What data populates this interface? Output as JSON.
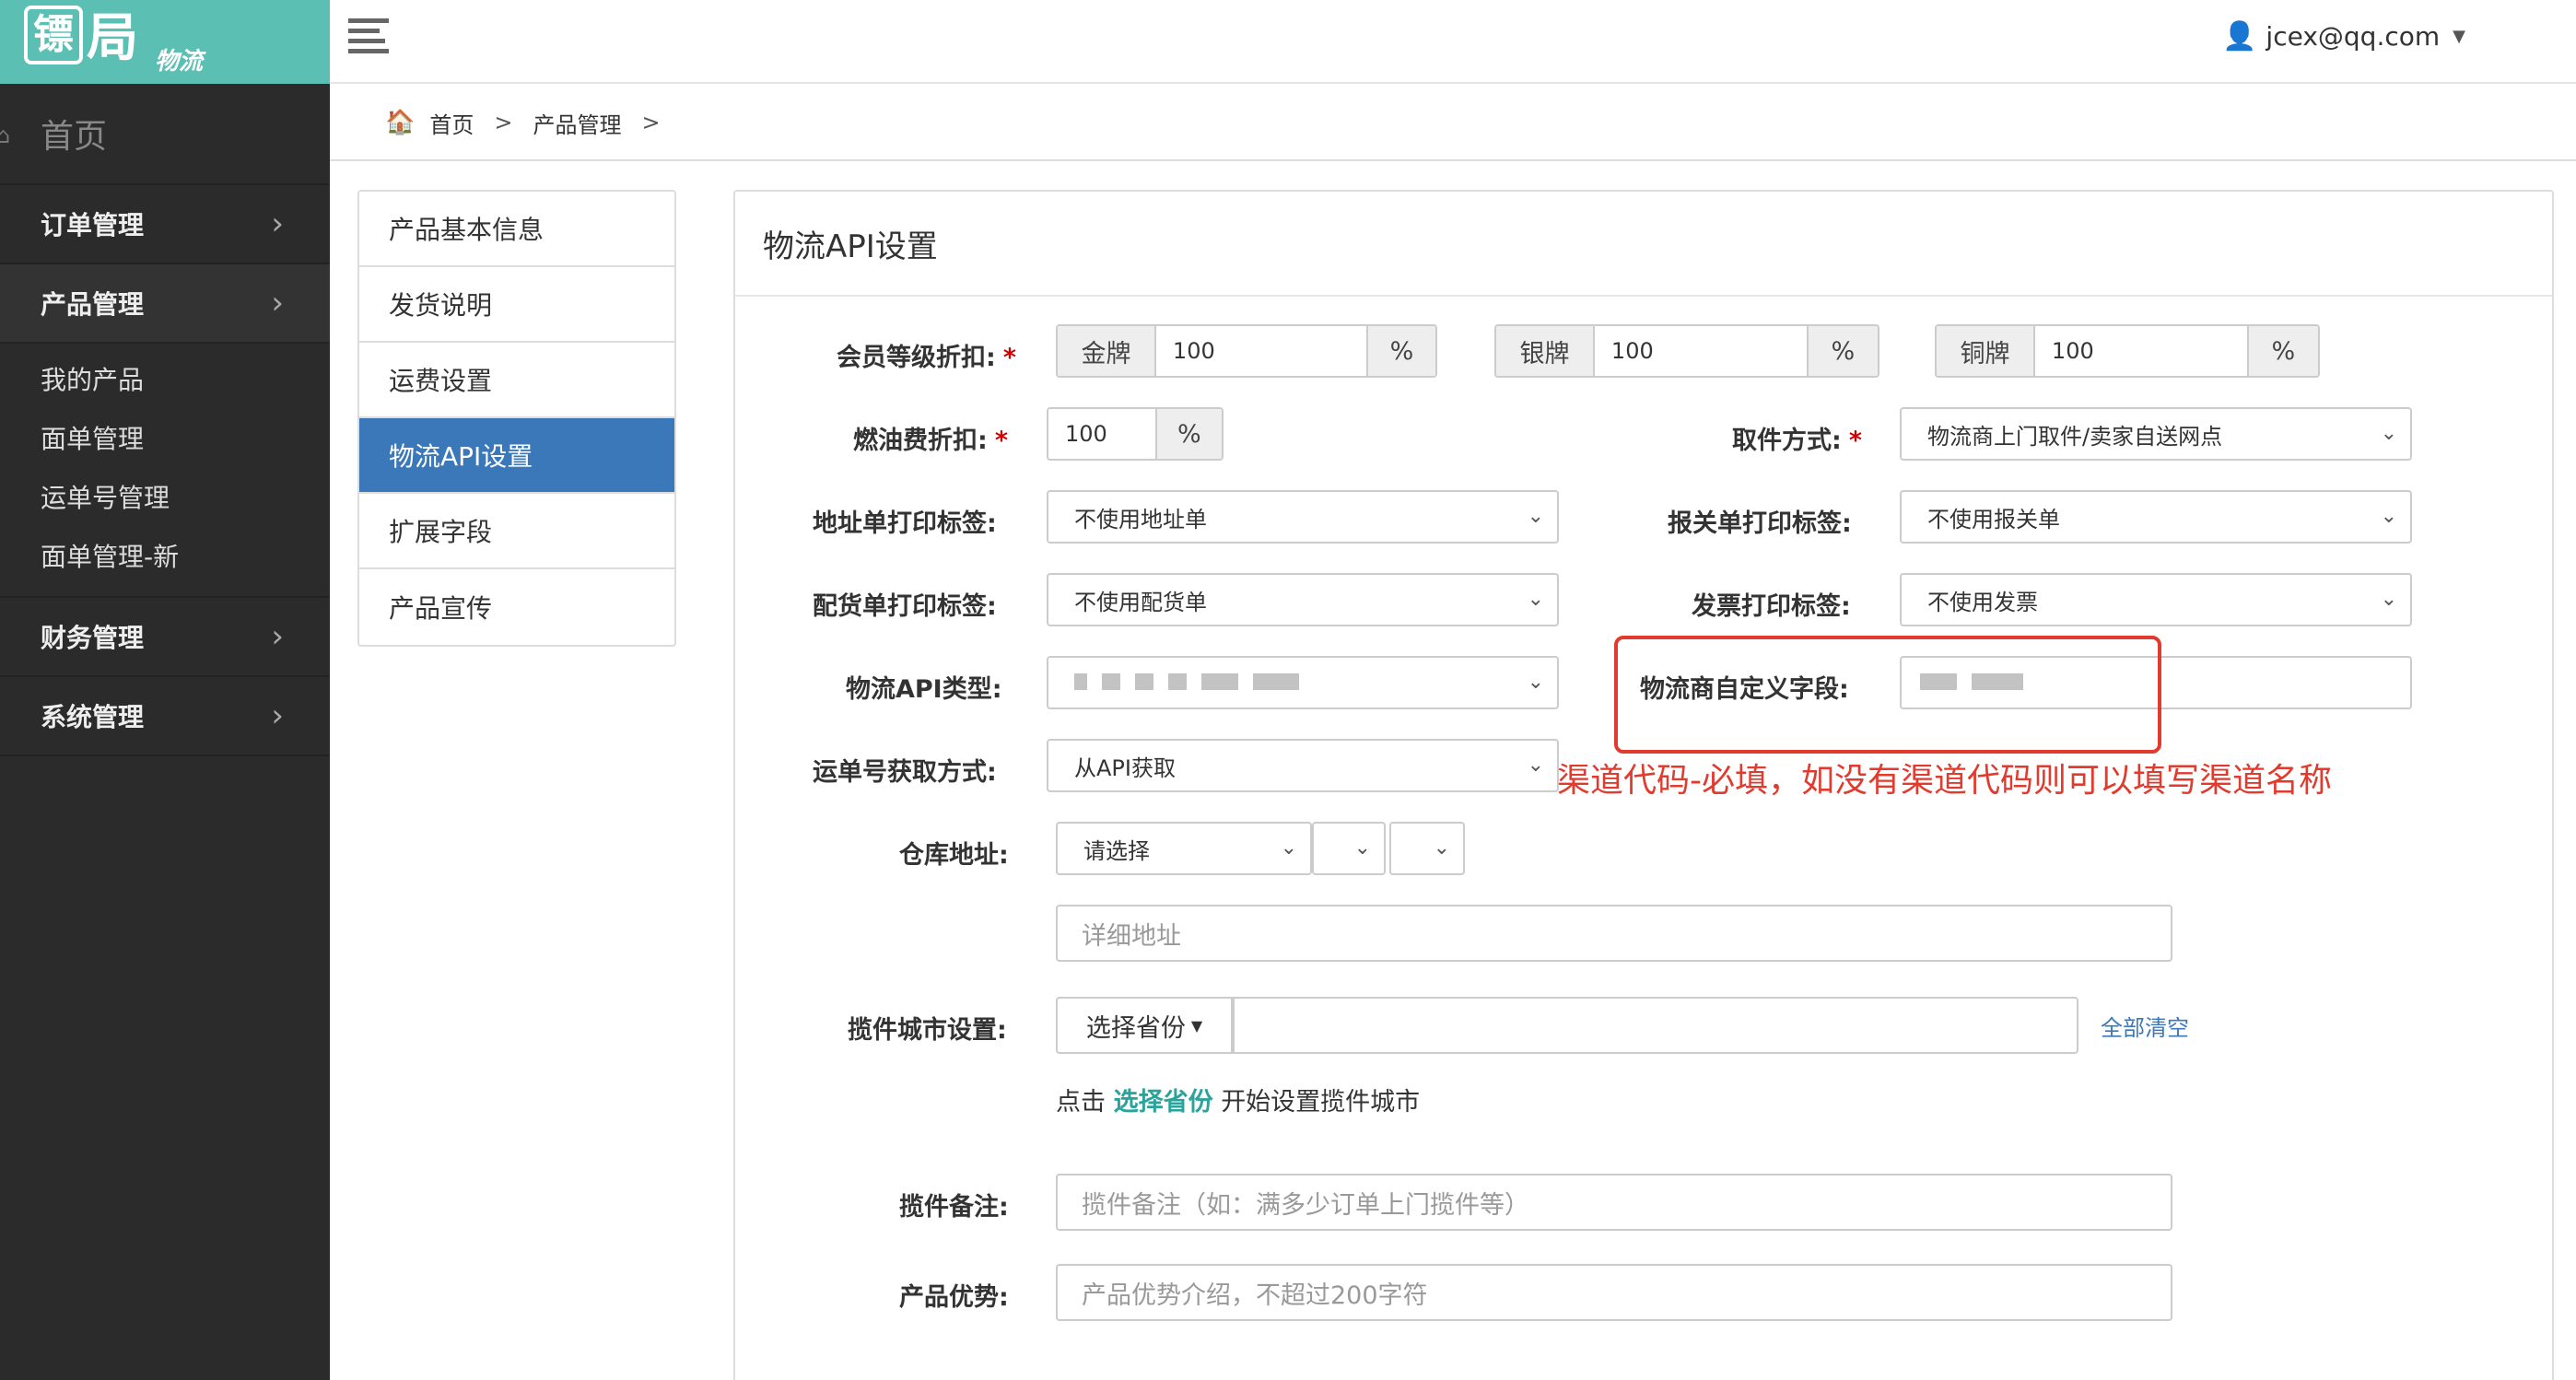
{
  "app": {
    "logo_mark": "镖",
    "logo_text": "局",
    "logo_sub": "物流"
  },
  "sidebar": {
    "home": "首页",
    "items": [
      {
        "label": "订单管理"
      },
      {
        "label": "产品管理"
      },
      {
        "label": "财务管理"
      },
      {
        "label": "系统管理"
      }
    ],
    "sub_items": [
      "我的产品",
      "面单管理",
      "运单号管理",
      "面单管理-新"
    ]
  },
  "topbar": {
    "user": "jcex@qq.com"
  },
  "breadcrumb": {
    "items": [
      "首页",
      "产品管理"
    ],
    "sep": ">"
  },
  "submenu": {
    "items": [
      "产品基本信息",
      "发货说明",
      "运费设置",
      "物流API设置",
      "扩展字段",
      "产品宣传"
    ]
  },
  "panel": {
    "title": "物流API设置"
  },
  "form": {
    "member_discount": {
      "label": "会员等级折扣:",
      "gold": {
        "name": "金牌",
        "value": "100",
        "unit": "%"
      },
      "silver": {
        "name": "银牌",
        "value": "100",
        "unit": "%"
      },
      "bronze": {
        "name": "铜牌",
        "value": "100",
        "unit": "%"
      }
    },
    "fuel_discount": {
      "label": "燃油费折扣:",
      "value": "100",
      "unit": "%"
    },
    "pickup": {
      "label": "取件方式:",
      "value": "物流商上门取件/卖家自送网点"
    },
    "address_label": {
      "label": "地址单打印标签:",
      "value": "不使用地址单"
    },
    "customs_label": {
      "label": "报关单打印标签:",
      "value": "不使用报关单"
    },
    "packing_label": {
      "label": "配货单打印标签:",
      "value": "不使用配货单"
    },
    "invoice_label": {
      "label": "发票打印标签:",
      "value": "不使用发票"
    },
    "api_type": {
      "label": "物流API类型:"
    },
    "custom_field": {
      "label": "物流商自定义字段:"
    },
    "tracking_method": {
      "label": "运单号获取方式:",
      "value": "从API获取"
    },
    "annotation": "渠道代码-必填，如没有渠道代码则可以填写渠道名称",
    "warehouse": {
      "label": "仓库地址:",
      "select_placeholder": "请选择",
      "detail_placeholder": "详细地址"
    },
    "pickup_city": {
      "label": "揽件城市设置:",
      "button": "选择省份",
      "clear": "全部清空"
    },
    "hint": {
      "prefix": "点击",
      "link": "选择省份",
      "suffix": "开始设置揽件城市"
    },
    "pickup_note": {
      "label": "揽件备注:",
      "placeholder": "揽件备注（如：满多少订单上门揽件等）"
    },
    "advantage": {
      "label": "产品优势:",
      "placeholder": "产品优势介绍，不超过200字符"
    }
  },
  "colors": {
    "logo_bg": "#5bbfb4",
    "sidebar_bg": "#2b2b2b",
    "active_menu": "#3a78b9",
    "annotation": "#e03b2e",
    "required": "#cc0000"
  },
  "icons": {
    "menu": "hamburger-icon",
    "user": "user-icon",
    "home": "home-icon",
    "chevron": "chevron-right-icon",
    "caret": "caret-down-icon"
  }
}
